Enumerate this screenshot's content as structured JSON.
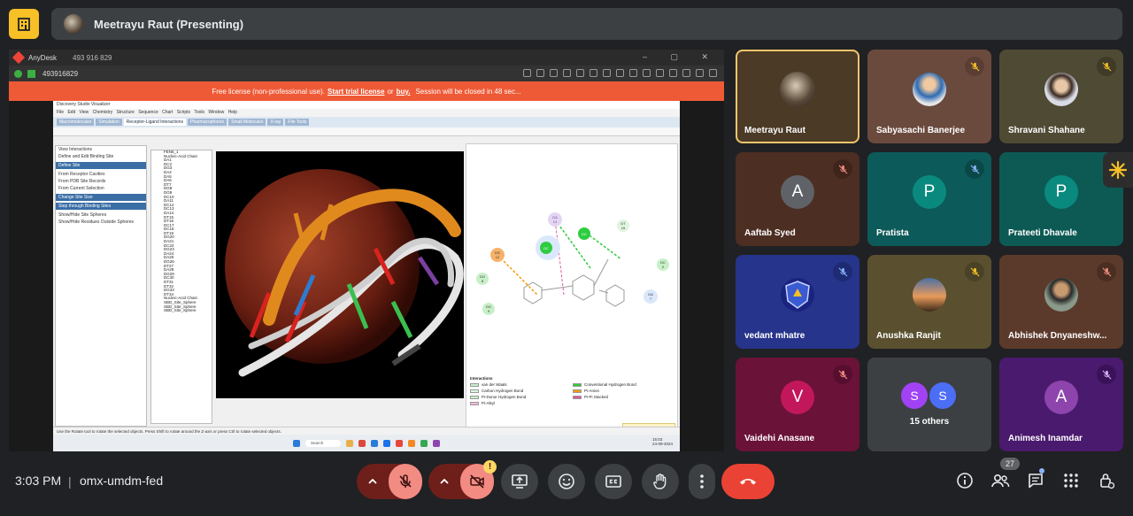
{
  "meeting": {
    "presenter_label": "Meetrayu Raut (Presenting)",
    "time": "3:03 PM",
    "meeting_code": "omx-umdm-fed",
    "participant_count": "27",
    "warning_badge": "!"
  },
  "shared_screen": {
    "anydesk": {
      "app_name": "AnyDesk",
      "tab_label": "493 916 829",
      "address": "493916829"
    },
    "license_banner": {
      "prefix": "Free license (non-professional use).",
      "trial_link": "Start trial license",
      "or": "or",
      "buy_link": "buy.",
      "suffix": "Session will be closed in 48 sec..."
    },
    "discovery_studio": {
      "title": "Discovery Studio Visualizer",
      "menu": [
        "File",
        "Edit",
        "View",
        "Chemistry",
        "Structure",
        "Sequence",
        "Chart",
        "Scripts",
        "Tools",
        "Window",
        "Help"
      ],
      "tabs": [
        "Macromolecules",
        "Simulation",
        "Receptor-Ligand Interactions",
        "Pharmacophores",
        "Small Molecules",
        "X-ray",
        "File Tools"
      ],
      "active_tab": "Receptor-Ligand Interactions",
      "left_panel": {
        "sections": [
          "Define Site",
          "Change Site Size",
          "Step through Binding Sites"
        ],
        "lines": [
          "View Interactions",
          "Define and Edit Binding Site",
          "From Receptor Cavities",
          "From PDB Site Records",
          "From Current Selection",
          "Show/Hide Site Spheres",
          "Show/Hide Residues Outside Spheres"
        ]
      },
      "tree_items": [
        "FEN6_1",
        "Nucleic-Acid Chain",
        "DA1",
        "DC2",
        "DG3",
        "DA4",
        "DA5",
        "DA6",
        "DT7",
        "DG8",
        "DG9",
        "DC10",
        "DA11",
        "DC12",
        "DC13",
        "DA14",
        "DT15",
        "DT16",
        "DC17",
        "DC18",
        "DT19",
        "DG20",
        "DA21",
        "DC22",
        "DG23",
        "DA24",
        "DA25",
        "DG26",
        "DT27",
        "DA28",
        "DG29",
        "DC30",
        "DT31",
        "DT32",
        "DG33",
        "DT34",
        "Nucleic-Acid Chain",
        "SBD_Site_Sphere",
        "SBD_Site_Sphere",
        "SBD_Site_Sphere"
      ],
      "status_text": "Use the Rotate tool to rotate the selected objects. Press Shift to rotate around the Z-axis or press Ctrl to rotate selected objects.",
      "legend_title": "Interactions",
      "legend": [
        {
          "label": "van der Waals",
          "color": "#c8f0c8"
        },
        {
          "label": "Conventional Hydrogen Bond",
          "color": "#2ecc40"
        },
        {
          "label": "Carbon Hydrogen Bond",
          "color": "#dff5df"
        },
        {
          "label": "Pi-Anion",
          "color": "#f39c12"
        },
        {
          "label": "Pi-Donor Hydrogen Bond",
          "color": "#c8f0c8"
        },
        {
          "label": "Pi-Pi Stacked",
          "color": "#e056a0"
        },
        {
          "label": "Pi-Alkyl",
          "color": "#f5b7d9"
        }
      ],
      "enable_features": "Enable Additional Features",
      "residue_labels": [
        "DA 14",
        "DT 15",
        "DG 12",
        "DG 8",
        "DG 9",
        "DC 2",
        "DA 7"
      ],
      "search_placeholder": "Search",
      "clock": "15:03",
      "date": "24-09-2024"
    }
  },
  "participants": [
    {
      "name": "Meetrayu Raut",
      "type": "photo",
      "muted": false,
      "active": true,
      "bg": "#4a3a26"
    },
    {
      "name": "Sabyasachi Banerjee",
      "type": "photo",
      "muted": true,
      "bg": "#6b4a3e"
    },
    {
      "name": "Shravani Shahane",
      "type": "photo",
      "muted": true,
      "bg": "#4f4a34"
    },
    {
      "name": "Aaftab Syed",
      "type": "letter",
      "letter": "A",
      "muted": true,
      "bg": "#4d2e23",
      "avatar_color": "#5f6368"
    },
    {
      "name": "Pratista",
      "type": "letter",
      "letter": "P",
      "muted": true,
      "bg": "#0d5a5a",
      "avatar_color": "#0a8a7e"
    },
    {
      "name": "Prateeti Dhavale",
      "type": "letter",
      "letter": "P",
      "muted": false,
      "bg": "#0d5a55",
      "avatar_color": "#0a8a7e"
    },
    {
      "name": "vedant mhatre",
      "type": "photo",
      "muted": true,
      "bg": "#27348b"
    },
    {
      "name": "Anushka Ranjit",
      "type": "photo",
      "muted": true,
      "bg": "#5a5030"
    },
    {
      "name": "Abhishek Dnyaneshw...",
      "type": "photo",
      "muted": true,
      "bg": "#5c3a2b"
    },
    {
      "name": "Vaidehi Anasane",
      "type": "letter",
      "letter": "V",
      "muted": true,
      "bg": "#6b1239",
      "avatar_color": "#c2185b"
    },
    {
      "name": "15 others",
      "type": "group",
      "letters": [
        "S",
        "S"
      ],
      "bg": "#3c4043"
    },
    {
      "name": "Animesh Inamdar",
      "type": "letter",
      "letter": "A",
      "muted": true,
      "bg": "#4a1a6e",
      "avatar_color": "#8e44ad"
    }
  ],
  "colors": {
    "background": "#202124",
    "end_call": "#ea4335",
    "muted_control": "#f28b82",
    "accent_yellow": "#f6c026",
    "license_banner": "#ef5a36"
  },
  "icons": {
    "bottom_controls": [
      "chevron-up-icon",
      "mic-off-icon",
      "chevron-up-icon",
      "camera-off-icon",
      "present-screen-icon",
      "emoji-icon",
      "captions-icon",
      "raise-hand-icon",
      "more-options-icon",
      "end-call-icon"
    ],
    "right_controls": [
      "info-icon",
      "people-icon",
      "chat-icon",
      "activities-icon",
      "host-controls-icon"
    ]
  }
}
